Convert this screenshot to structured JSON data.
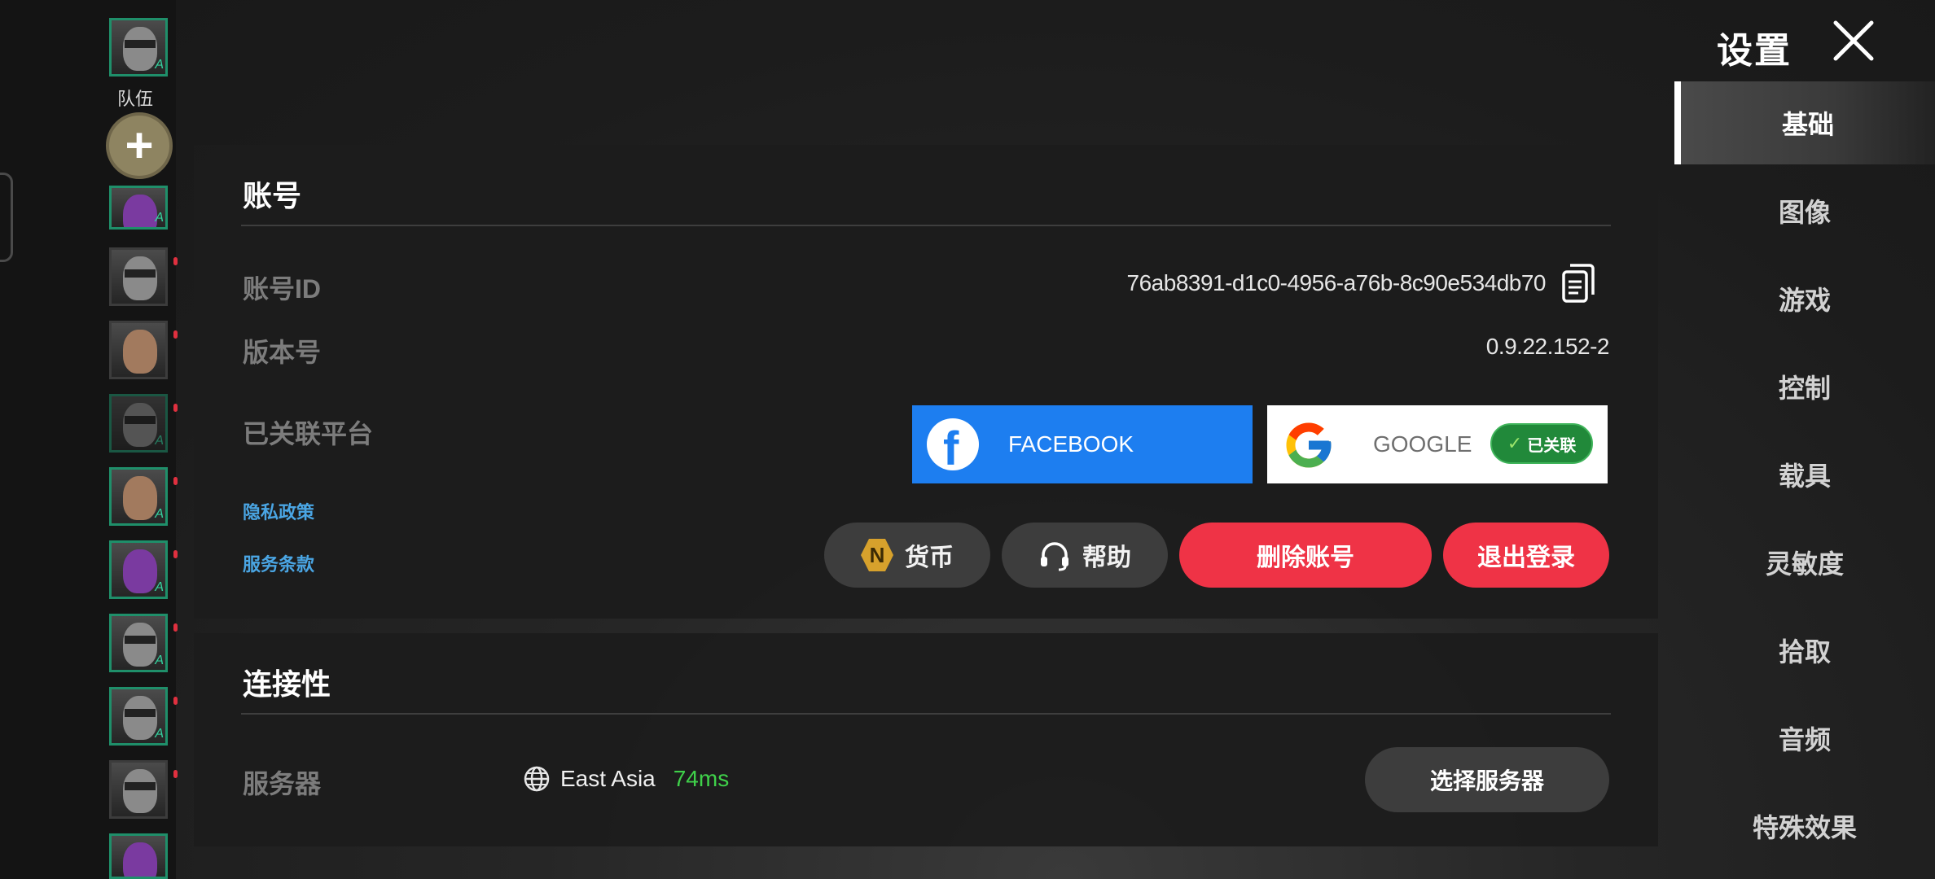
{
  "team": {
    "label": "队伍",
    "add_button_symbol": "+",
    "members": [
      {
        "style": "helmet",
        "highlight": true
      },
      {
        "style": "purple"
      },
      {
        "style": "helmet"
      },
      {
        "style": "human"
      },
      {
        "style": "ghost"
      },
      {
        "style": "human-green"
      },
      {
        "style": "purple"
      },
      {
        "style": "helmet"
      },
      {
        "style": "helmet"
      },
      {
        "style": "helmet"
      },
      {
        "style": "purple"
      }
    ]
  },
  "header": {
    "title": "设置",
    "close_icon": "close-icon"
  },
  "nav": {
    "items": [
      {
        "label": "基础",
        "active": true
      },
      {
        "label": "图像"
      },
      {
        "label": "游戏"
      },
      {
        "label": "控制"
      },
      {
        "label": "载具"
      },
      {
        "label": "灵敏度"
      },
      {
        "label": "拾取"
      },
      {
        "label": "音频"
      },
      {
        "label": "特殊效果"
      }
    ]
  },
  "account": {
    "title": "账号",
    "id_label": "账号ID",
    "id_value": "76ab8391-d1c0-4956-a76b-8c90e534db70",
    "version_label": "版本号",
    "version_value": "0.9.22.152-2",
    "platforms_label": "已关联平台",
    "facebook_label": "FACEBOOK",
    "google_label": "GOOGLE",
    "google_linked_badge": "已关联",
    "privacy_link": "隐私政策",
    "terms_link": "服务条款",
    "currency_button": "货币",
    "currency_icon_letter": "N",
    "help_button": "帮助",
    "delete_button": "删除账号",
    "logout_button": "退出登录"
  },
  "connectivity": {
    "title": "连接性",
    "server_label": "服务器",
    "server_name": "East Asia",
    "ping": "74ms",
    "select_server_button": "选择服务器"
  },
  "colors": {
    "accent_red": "#ef3346",
    "facebook_blue": "#1d7ef0",
    "linked_green": "#21893a",
    "ping_green": "#3fd14a",
    "link_blue": "#4aa5e3"
  }
}
